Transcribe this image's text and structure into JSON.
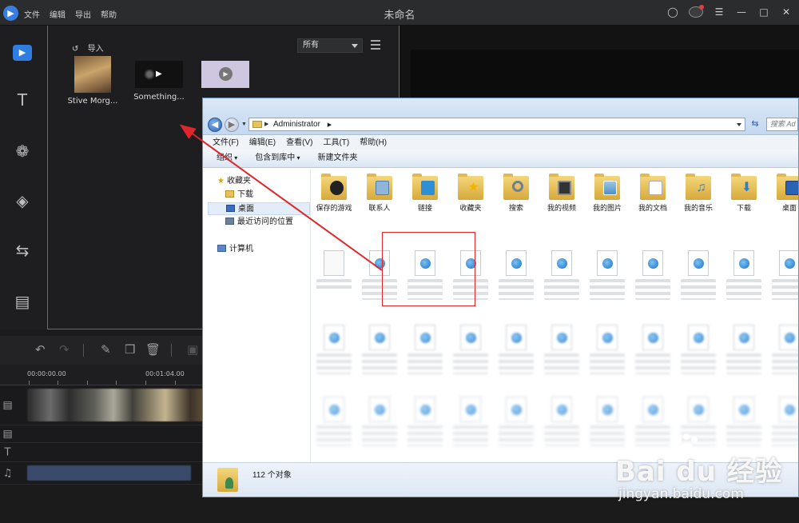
{
  "editor": {
    "window_title": "未命名",
    "menu": [
      "文件",
      "编辑",
      "导出",
      "帮助"
    ],
    "media_panel": {
      "import_label": "导入",
      "filter_value": "所有",
      "items": [
        {
          "label": "Stive Morg..."
        },
        {
          "label": "Something..."
        },
        {
          "label": ""
        }
      ]
    },
    "timeline": {
      "timecodes": [
        "00:00:00.00",
        "00:01:04.00"
      ]
    }
  },
  "explorer": {
    "address_path": [
      "Administrator"
    ],
    "search_placeholder": "搜索 Ad",
    "menu": [
      "文件(F)",
      "编辑(E)",
      "查看(V)",
      "工具(T)",
      "帮助(H)"
    ],
    "commands": {
      "organize": "组织",
      "include_library": "包含到库中",
      "new_folder": "新建文件夹"
    },
    "nav": {
      "favorites": "收藏夹",
      "downloads": "下载",
      "desktop": "桌面",
      "recent": "最近访问的位置",
      "computer": "计算机"
    },
    "folders": [
      "保存的游戏",
      "联系人",
      "链接",
      "收藏夹",
      "搜索",
      "我的视频",
      "我的图片",
      "我的文档",
      "我的音乐",
      "下载",
      "桌面"
    ],
    "status_count": "112 个对象"
  },
  "watermark": {
    "brand": "Bai du 经验",
    "url": "jingyan.baidu.com"
  },
  "colors": {
    "accent": "#2f7de1",
    "highlight": "#e0262a",
    "folder": "#e8c25a"
  }
}
